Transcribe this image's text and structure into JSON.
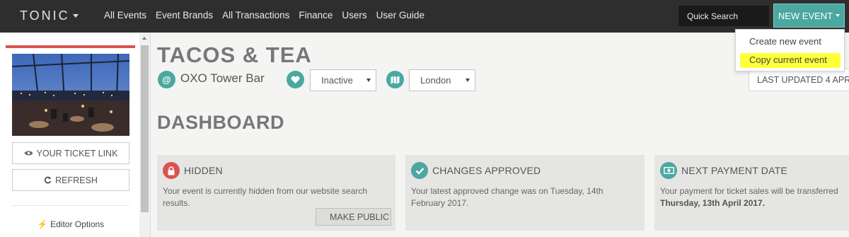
{
  "nav": {
    "logo": "TONIC",
    "links": [
      "All Events",
      "Event Brands",
      "All Transactions",
      "Finance",
      "Users",
      "User Guide"
    ],
    "search_placeholder": "Quick Search",
    "new_event_label": "NEW EVENT"
  },
  "dropdown": {
    "items": [
      "Create new event",
      "Copy current event"
    ],
    "highlight_color": "#ffff3a"
  },
  "sidebar": {
    "ticket_link_label": "YOUR TICKET LINK",
    "refresh_label": "REFRESH",
    "editor_options_label": "Editor Options"
  },
  "event": {
    "title": "TACOS & TEA",
    "venue": "OXO Tower Bar",
    "status_selected": "Inactive",
    "city_selected": "London",
    "last_updated": "LAST UPDATED 4 APR"
  },
  "dashboard": {
    "title": "DASHBOARD",
    "cards": [
      {
        "heading": "HIDDEN",
        "text": "Your event is currently hidden from our website search results.",
        "button_label": "MAKE PUBLIC",
        "icon": "lock-icon",
        "icon_color": "#d9534f"
      },
      {
        "heading": "CHANGES APPROVED",
        "text": "Your latest approved change was on Tuesday, 14th February 2017.",
        "icon": "check-icon",
        "icon_color": "#4aa8a0"
      },
      {
        "heading": "NEXT PAYMENT DATE",
        "text_prefix": "Your payment for ticket sales will be transferred",
        "text_bold": "Thursday, 13th April 2017.",
        "icon": "money-icon",
        "icon_color": "#4aa8a0"
      }
    ]
  },
  "colors": {
    "accent": "#4aa8a0",
    "nav_bg": "#2e2e2e",
    "alert": "#d9534f"
  }
}
